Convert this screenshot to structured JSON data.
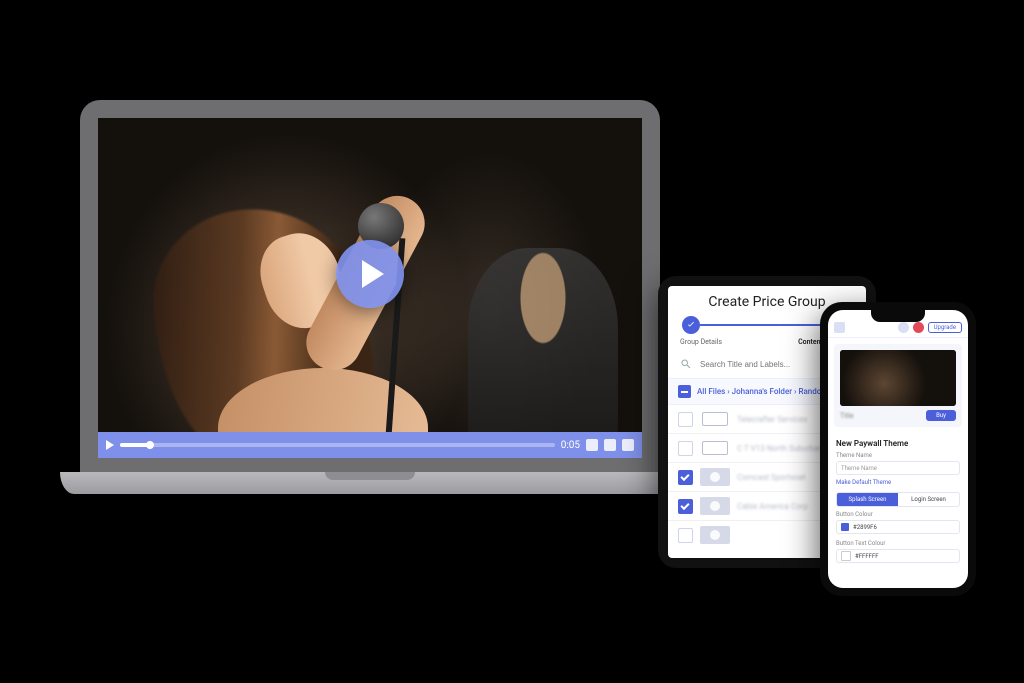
{
  "video_player": {
    "timestamp": "0:05"
  },
  "tablet": {
    "title": "Create Price Group",
    "steps": {
      "step1_label": "Group Details",
      "step2_label": "Content Selection"
    },
    "search_placeholder": "Search Title and Labels...",
    "breadcrumb": "All Files › Johanna's Folder › Random",
    "rows": [
      {
        "checked": false,
        "kind": "folder",
        "label_blurred": "Telecrafter Services"
      },
      {
        "checked": false,
        "kind": "folder",
        "label_blurred": "C T V13 North Suburban"
      },
      {
        "checked": true,
        "kind": "video",
        "label_blurred": "Comcast Sportsnet"
      },
      {
        "checked": true,
        "kind": "video",
        "label_blurred": "Cable America Corp"
      }
    ]
  },
  "phone": {
    "upgrade_label": "Upgrade",
    "preview_title_blurred": "Title",
    "preview_button": "Buy",
    "panel_title": "New Paywall Theme",
    "theme_name_label": "Theme Name",
    "theme_name_placeholder": "Theme Name",
    "make_default": "Make Default Theme",
    "tab_splash": "Splash Screen",
    "tab_login": "Login Screen",
    "button_colour_label": "Button Colour",
    "button_colour_value": "#2899F6",
    "button_text_colour_label": "Button Text Colour",
    "button_text_colour_value": "#FFFFFF"
  },
  "colors": {
    "accent": "#4a5fd9"
  }
}
